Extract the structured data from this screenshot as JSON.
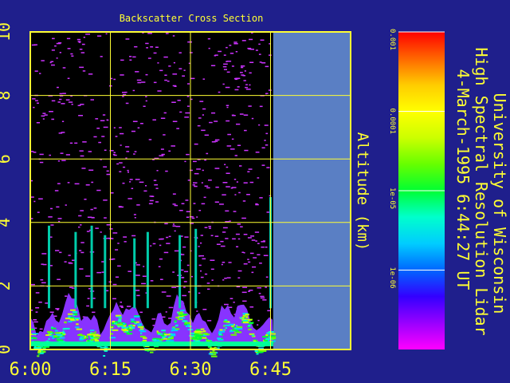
{
  "colors": {
    "background": "#1f1f8c",
    "axis": "#ffff33",
    "plot_bg": "#000000",
    "no_data": "#5a7fc4",
    "noise": "#cc33ff"
  },
  "chart_data": {
    "type": "heatmap",
    "title": "Backscatter Cross Section",
    "ylabel": "Altitude (km)",
    "xlabel": "",
    "x_ticks": [
      "6:00",
      "6:15",
      "6:30",
      "6:45"
    ],
    "y_ticks": [
      "0",
      "2",
      "4",
      "6",
      "8",
      "10"
    ],
    "ylim": [
      0,
      10
    ],
    "xlim_minutes": [
      0,
      60
    ],
    "data_end_minute": 45.5,
    "grid": true,
    "colorbar": {
      "scale": "log",
      "range": [
        1e-07,
        0.001
      ],
      "tick_labels": [
        "0.001",
        "0.0001",
        "1e-05",
        "1e-06"
      ],
      "tick_values": [
        0.001,
        0.0001,
        1e-05,
        1e-06
      ],
      "colormap": [
        "#ff00ff",
        "#9900ff",
        "#3300ff",
        "#0066ff",
        "#00ccff",
        "#00ffcc",
        "#00ff33",
        "#66ff00",
        "#ccff00",
        "#ffff00",
        "#ffcc00",
        "#ff6600",
        "#ff0000"
      ]
    },
    "plumes": [
      {
        "minute": 3.5,
        "top_km": 3.9
      },
      {
        "minute": 8.5,
        "top_km": 3.7
      },
      {
        "minute": 11.5,
        "top_km": 3.9
      },
      {
        "minute": 14.0,
        "top_km": 3.6
      },
      {
        "minute": 19.5,
        "top_km": 3.5
      },
      {
        "minute": 22.0,
        "top_km": 3.7
      },
      {
        "minute": 28.0,
        "top_km": 3.6
      },
      {
        "minute": 31.0,
        "top_km": 3.8
      },
      {
        "minute": 45.0,
        "top_km": 4.8
      }
    ]
  },
  "side_title": {
    "line1": "University of Wisconsin",
    "line2": "High Spectral Resolution Lidar",
    "line3": "4-March-1995   6:44:27 UT"
  }
}
